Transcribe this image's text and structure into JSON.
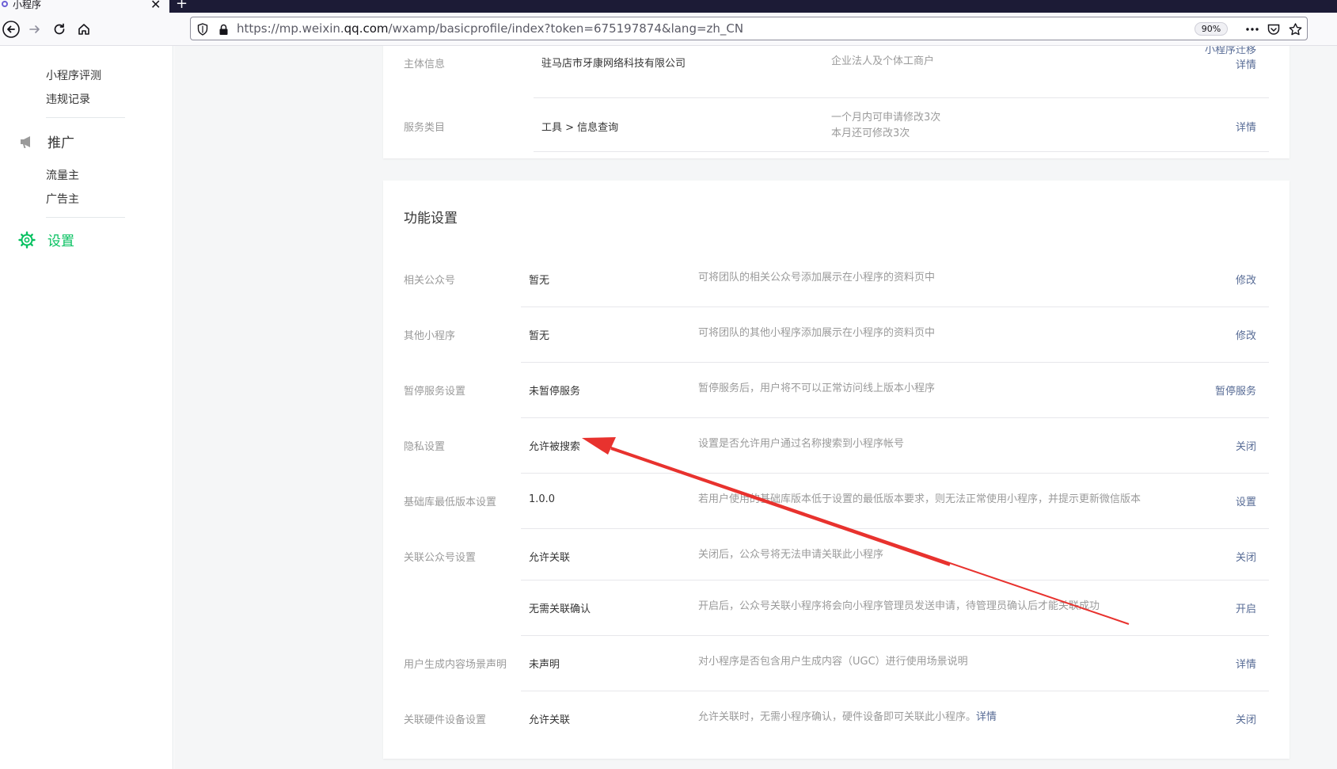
{
  "browser": {
    "tab_title": "小程序",
    "tab_close": "✕",
    "new_tab": "+",
    "url_prefix": "https://mp.weixin.",
    "url_domain": "qq.com",
    "url_path": "/wxamp/basicprofile/index?token=675197874&lang=zh_CN",
    "zoom": "90%",
    "icons": [
      "back-icon",
      "forward-icon",
      "reload-icon",
      "home-icon",
      "shield-icon",
      "lock-icon",
      "more-icon",
      "pocket-icon",
      "bookmark-star-icon"
    ]
  },
  "sidebar": {
    "items_top": [
      "小程序评测",
      "违规记录"
    ],
    "section_promo": {
      "label": "推广",
      "icon": "megaphone-icon",
      "items": [
        "流量主",
        "广告主"
      ]
    },
    "section_settings": {
      "label": "设置",
      "icon": "gear-icon"
    }
  },
  "basic_info": {
    "rows": [
      {
        "label": "主体信息",
        "value": "驻马店市牙康网络科技有限公司",
        "desc": "企业法人及个体工商户",
        "actions": [
          "小程序迁移",
          "详情"
        ]
      },
      {
        "label": "服务类目",
        "value": "工具 > 信息查询",
        "desc_lines": [
          "一个月内可申请修改3次",
          "本月还可修改3次"
        ],
        "action": "详情"
      }
    ]
  },
  "feature_settings": {
    "title": "功能设置",
    "rows": [
      {
        "label": "相关公众号",
        "value": "暂无",
        "desc": "可将团队的相关公众号添加展示在小程序的资料页中",
        "action": "修改"
      },
      {
        "label": "其他小程序",
        "value": "暂无",
        "desc": "可将团队的其他小程序添加展示在小程序的资料页中",
        "action": "修改"
      },
      {
        "label": "暂停服务设置",
        "value": "未暂停服务",
        "desc": "暂停服务后，用户将不可以正常访问线上版本小程序",
        "action": "暂停服务"
      },
      {
        "label": "隐私设置",
        "value": "允许被搜索",
        "desc": "设置是否允许用户通过名称搜索到小程序帐号",
        "action": "关闭"
      },
      {
        "label": "基础库最低版本设置",
        "value": "1.0.0",
        "desc": "若用户使用的基础库版本低于设置的最低版本要求，则无法正常使用小程序，并提示更新微信版本",
        "action": "设置"
      },
      {
        "label": "关联公众号设置",
        "value": "允许关联",
        "desc": "关闭后，公众号将无法申请关联此小程序",
        "action": "关闭"
      },
      {
        "label": "",
        "value": "无需关联确认",
        "desc": "开启后，公众号关联小程序将会向小程序管理员发送申请，待管理员确认后才能关联成功",
        "action": "开启"
      },
      {
        "label": "用户生成内容场景声明",
        "value": "未声明",
        "desc": "对小程序是否包含用户生成内容（UGC）进行使用场景说明",
        "action": "详情"
      },
      {
        "label": "关联硬件设备设置",
        "value": "允许关联",
        "desc": "允许关联时，无需小程序确认，硬件设备即可关联此小程序。",
        "desc_link": "详情",
        "action": "关闭"
      }
    ]
  },
  "colors": {
    "accent_green": "#07c160",
    "link_blue": "#576b95",
    "annotation_red": "#e8322e"
  }
}
